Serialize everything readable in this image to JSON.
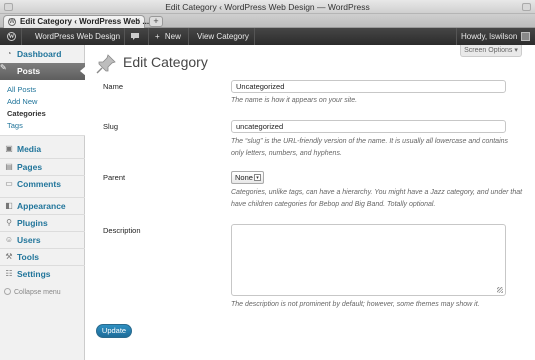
{
  "browser": {
    "window_title": "Edit Category ‹ WordPress Web Design — WordPress",
    "tab_title": "Edit Category ‹ WordPress Web ...",
    "tab_close": "×",
    "new_tab": "+"
  },
  "admin_bar": {
    "wp_logo": "W",
    "site_name": "WordPress Web Design",
    "new_label": "New",
    "new_plus": "+",
    "view_label": "View Category",
    "greeting": "Howdy, lswilson"
  },
  "sidebar": {
    "dashboard": "Dashboard",
    "posts": "Posts",
    "submenu": [
      "All Posts",
      "Add New",
      "Categories",
      "Tags"
    ],
    "media": "Media",
    "pages": "Pages",
    "comments": "Comments",
    "appearance": "Appearance",
    "plugins": "Plugins",
    "users": "Users",
    "tools": "Tools",
    "settings": "Settings",
    "collapse": "Collapse menu"
  },
  "main": {
    "screen_options": "Screen Options ▾",
    "title": "Edit Category",
    "name": {
      "label": "Name",
      "value": "Uncategorized",
      "help": "The name is how it appears on your site."
    },
    "slug": {
      "label": "Slug",
      "value": "uncategorized",
      "help": "The “slug” is the URL-friendly version of the name. It is usually all lowercase and contains only letters, numbers, and hyphens."
    },
    "parent": {
      "label": "Parent",
      "selected": "None",
      "help": "Categories, unlike tags, can have a hierarchy. You might have a Jazz category, and under that have children categories for Bebop and Big Band. Totally optional."
    },
    "description": {
      "label": "Description",
      "value": "",
      "help": "The description is not prominent by default; however, some themes may show it."
    },
    "update_button": "Update"
  }
}
